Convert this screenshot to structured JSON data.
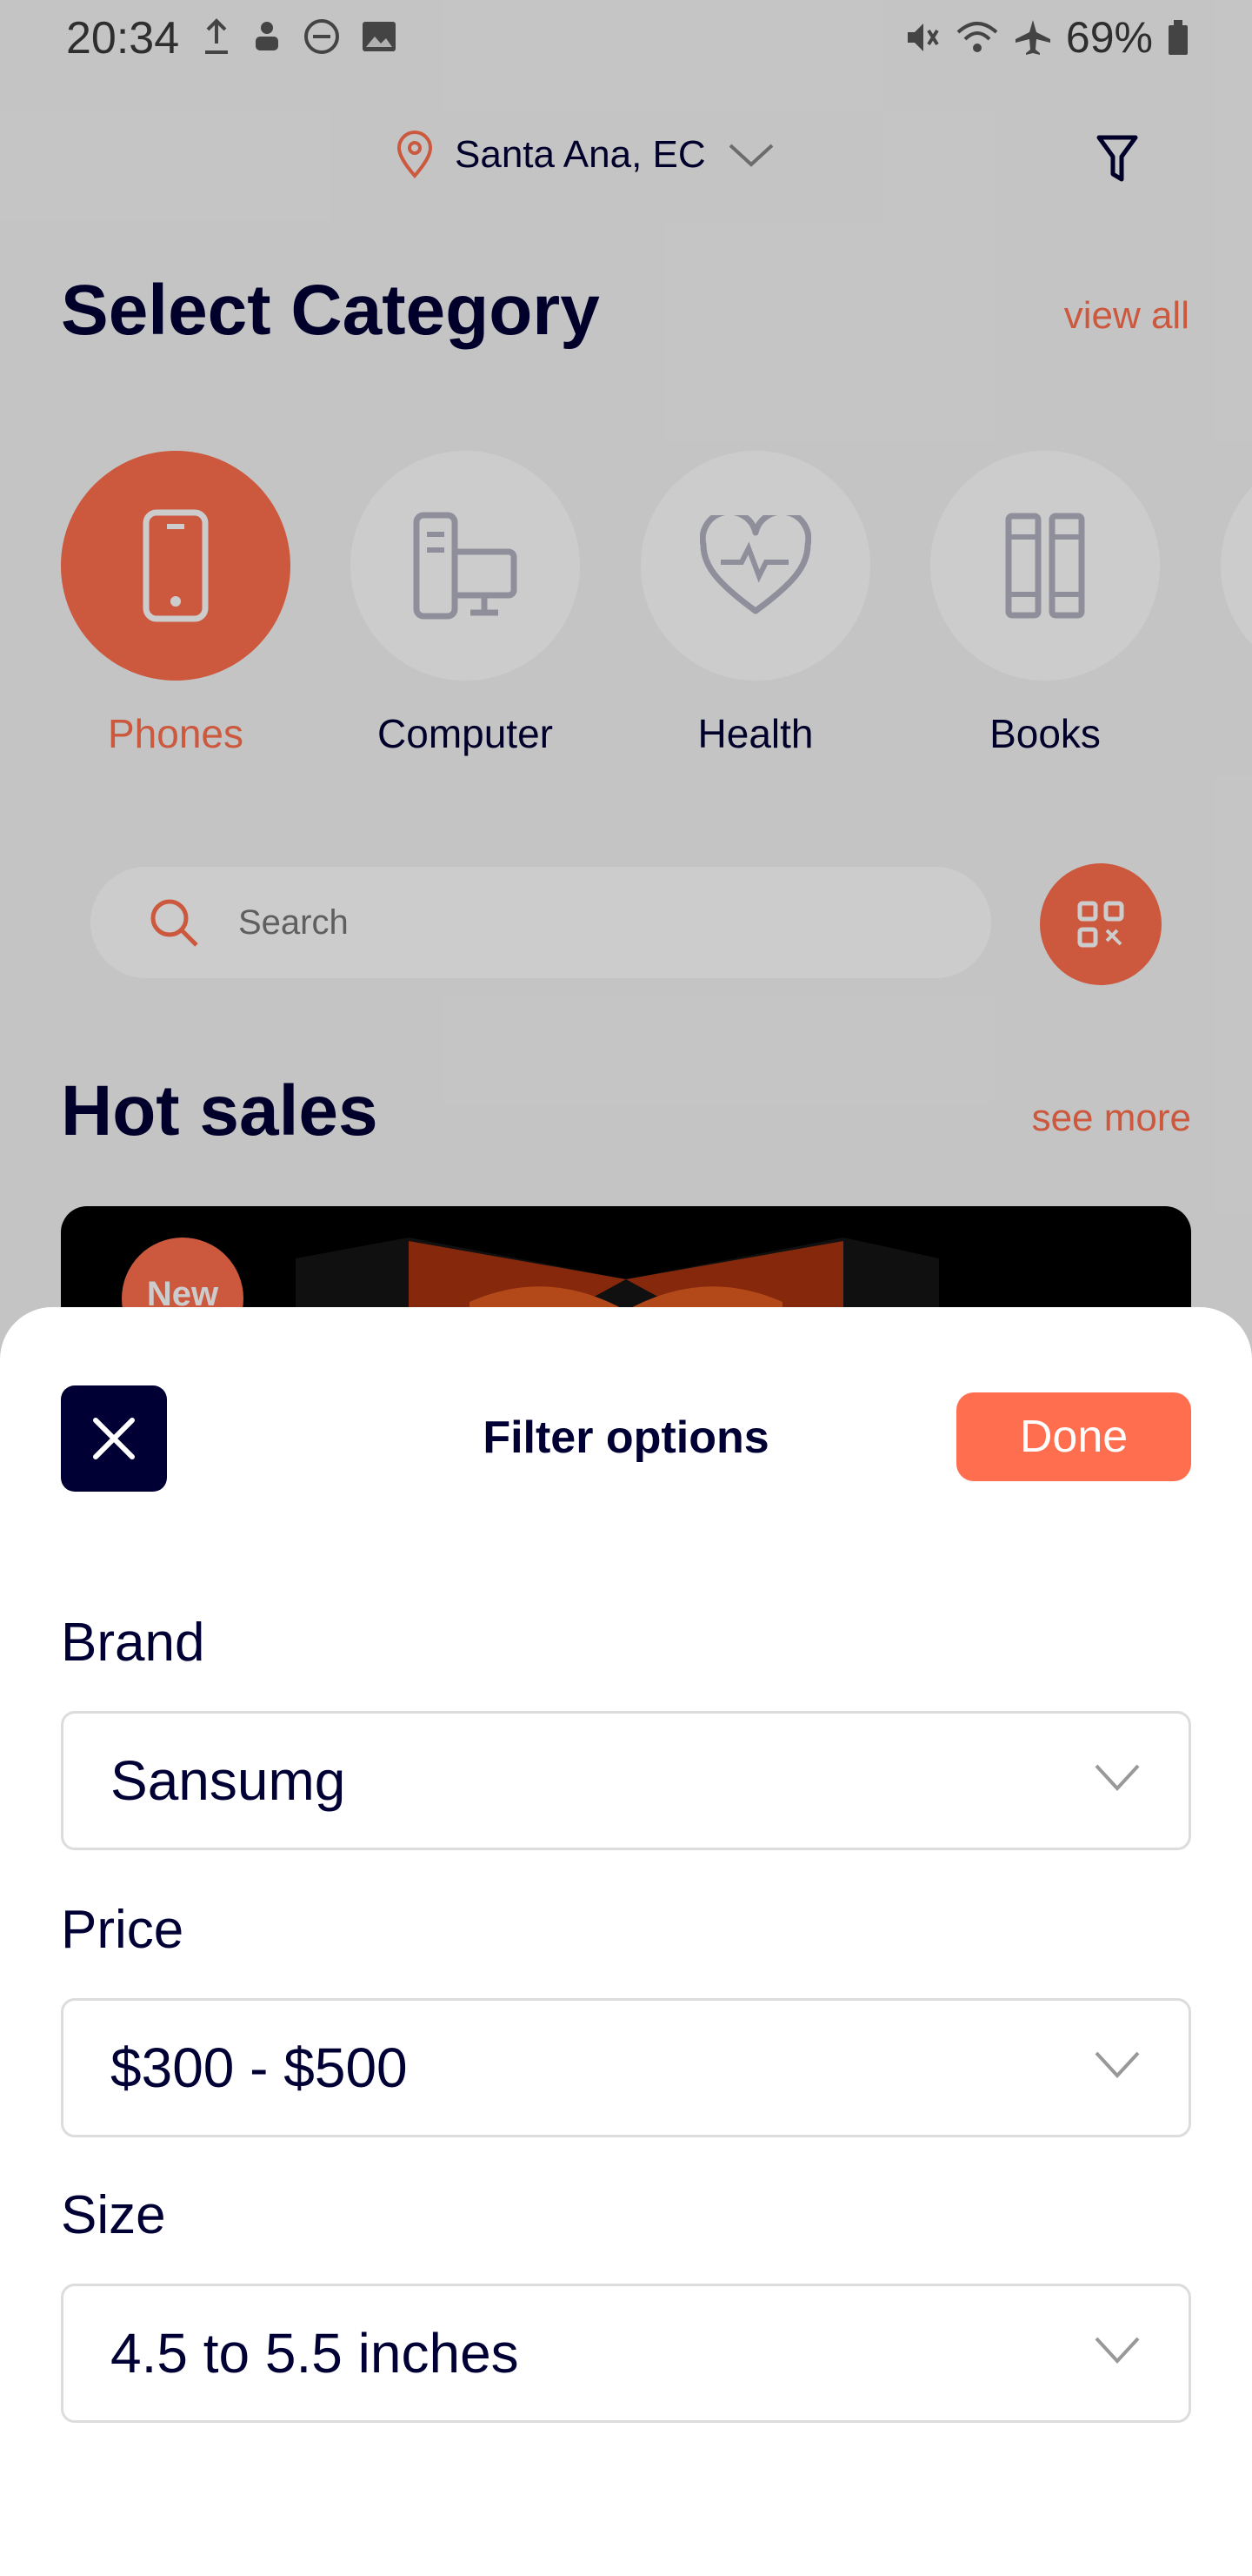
{
  "status_bar": {
    "time": "20:34",
    "battery": "69%"
  },
  "header": {
    "location": "Santa Ana, EC"
  },
  "categories_section": {
    "title": "Select Category",
    "view_all": "view all",
    "items": [
      {
        "label": "Phones",
        "icon": "phone-icon",
        "active": true
      },
      {
        "label": "Computer",
        "icon": "computer-icon",
        "active": false
      },
      {
        "label": "Health",
        "icon": "heart-pulse-icon",
        "active": false
      },
      {
        "label": "Books",
        "icon": "books-icon",
        "active": false
      }
    ]
  },
  "search": {
    "placeholder": "Search"
  },
  "hot_sales": {
    "title": "Hot sales",
    "see_more": "see more",
    "badge": "New"
  },
  "filter_sheet": {
    "title": "Filter options",
    "done_label": "Done",
    "fields": [
      {
        "label": "Brand",
        "value": "Sansumg"
      },
      {
        "label": "Price",
        "value": "$300 - $500"
      },
      {
        "label": "Size",
        "value": "4.5 to 5.5 inches"
      }
    ]
  },
  "colors": {
    "accent": "#FF6E4E",
    "dark": "#010035"
  }
}
